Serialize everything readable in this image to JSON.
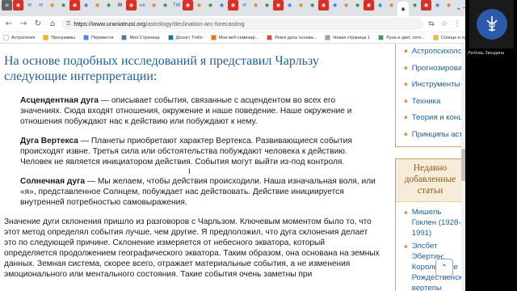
{
  "browser": {
    "tabs": [
      "≡",
      "◉",
      "✉",
      "✉",
      "◉",
      "◉",
      "◉",
      "◉",
      "◉",
      "◉",
      "W",
      "◉",
      "нк",
      "◉",
      "◉",
      "TW",
      "◉",
      "◉",
      "◉",
      "◉",
      "◉",
      "✉",
      "◉",
      "◉",
      "◉",
      "◉",
      "◉",
      "◉",
      "◉",
      "◉",
      "◉",
      "◉",
      "◉",
      "◉",
      "◉",
      "◉",
      "◉",
      "◉",
      "◉",
      "◉"
    ],
    "window_controls": {
      "dropdown": "⌄",
      "minimize": "—",
      "maximize": "☐",
      "close": "✕"
    },
    "url_domain": "https://www.uraniatrust.org",
    "url_path": "/astrology/declination-arc-forecasting",
    "nav": {
      "back": "←",
      "forward": "→",
      "reload": "↻",
      "home": "⌂"
    },
    "toolbar_icons": {
      "translate": "⇆",
      "bookmark": "☆",
      "extensions": "⋮"
    }
  },
  "bookmarks": [
    {
      "label": "Астрология",
      "color": "#ffffff"
    },
    {
      "label": "Программы",
      "color": "#f4b400"
    },
    {
      "label": "Перевести",
      "color": "#4285f4"
    },
    {
      "label": "Моя Страница",
      "color": "#4a76a8"
    },
    {
      "label": "Доски | Trello",
      "color": "#0079bf"
    },
    {
      "label": "Мои веб-семинар...",
      "color": "#ff6b00"
    },
    {
      "label": "Рекги даты основа...",
      "color": "#ea4335"
    },
    {
      "label": "Новая страница 1",
      "color": "#9e9e9e"
    },
    {
      "label": "Луна и цвет, сего...",
      "color": "#34a853"
    },
    {
      "label": "Солнце и луна сег...",
      "color": "#fbbc04"
    }
  ],
  "article": {
    "heading": "На основе подобных исследований я представил Чарльзу следующие интерпретации:",
    "items": [
      {
        "term": "Асцендентная дуга",
        "text": " — описывает события, связанные с асцендентом во всех его значениях. Сюда входят отношения, окружение и наше поведение. Наше окружение и отношения побуждают нас к действию или побуждают к нему."
      },
      {
        "term": "Дуга Вертекса",
        "text": " — Планеты приобретают характер Вертекса. Развивающиеся события происходят извне. Третья сила или обстоятельства побуждают человека к действию. Человек не является инициатором действия. События могут выйти из-под контроля."
      },
      {
        "term": "Солнечная дуга",
        "text": " — Мы желаем, чтобы действия происходили. Наша изначальная воля, или «я», представленное Солнцем, побуждает нас действовать. Действие инициируется внутренней потребностью самовыражения."
      }
    ],
    "paragraph": "Значение дуги склонения пришло из разговоров с Чарльзом. Ключевым моментом было то, что этот метод определял события лучше, чем другие. Я предположил, что дуга склонения делает это по следующей причине. Склонение измеряется от небесного экватора, который определяется продолжением географического экватора. Таким образом, она основана на земных данных. Земная система, скорее всего, отражает материальные события, а не изменения эмоционального или ментального состояния. Такие события очень заметны при"
  },
  "sidebar": {
    "categories": [
      "Астропсихология",
      "Прогнозирование",
      "Инструменты",
      "Техника",
      "Теория и концепция",
      "Принципы астрологии"
    ],
    "recent_title": "Недавно добавленные статьи",
    "recent": [
      "Мишель Гоклен (1928-1991)",
      "Элсбет Эбертин: Королевские Рождественские вертепы"
    ]
  },
  "scroll_up": "⌃",
  "video": {
    "name": "Любовь Звездина"
  }
}
